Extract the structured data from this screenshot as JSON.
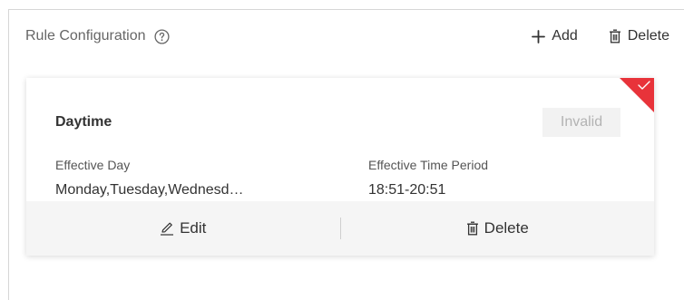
{
  "header": {
    "title": "Rule Configuration",
    "help_icon": "question-circle-icon",
    "add_label": "Add",
    "delete_label": "Delete"
  },
  "rule_card": {
    "name": "Daytime",
    "status": "Invalid",
    "corner_marker_color": "#e8333a",
    "day_label": "Effective Day",
    "day_value": "Monday,Tuesday,Wednesd…",
    "time_label": "Effective Time Period",
    "time_value": "18:51-20:51",
    "edit_label": "Edit",
    "delete_label": "Delete"
  }
}
